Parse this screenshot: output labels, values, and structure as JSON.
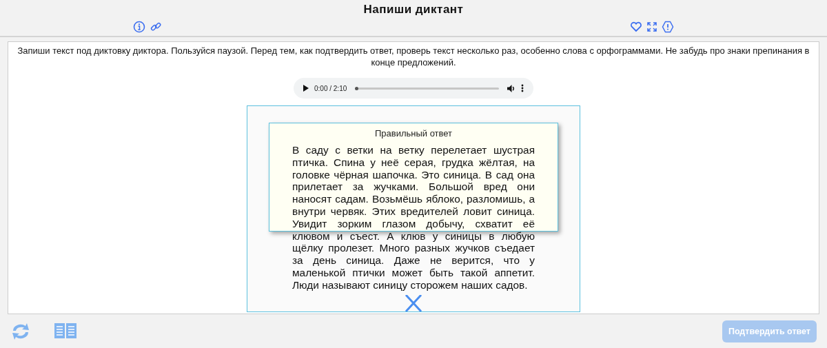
{
  "header": {
    "title": "Напиши диктант"
  },
  "instruction": "Запиши текст под диктовку диктора. Пользуйся паузой. Перед тем, как подтвердить ответ, проверь текст несколько раз, особенно слова с орфограммами. Не забудь про знаки препинания в конце предложений.",
  "audio": {
    "time": "0:00 / 2:10",
    "level": 0
  },
  "answer_popup": {
    "title": "Правильный ответ"
  },
  "dictation_text": "В саду с ветки на ветку перелетает шустрая птичка. Спина у неё серая, грудка жёлтая, на головке чёрная шапочка. Это синица. В сад она прилетает за жучками. Большой вред они наносят садам. Возьмёшь яблоко, разломишь, а внутри червяк. Этих вредителей ловит синица. Увидит зорким глазом добычу, схватит её клювом и съест. А клюв у синицы в любую щёлку пролезет. Много разных жучков съедает за день синица. Даже не верится, что у маленькой птички может быть такой аппетит. Люди называют синицу сторожем наших садов.",
  "submit_button": {
    "label": "Подтвердить ответ",
    "disabled": true
  }
}
